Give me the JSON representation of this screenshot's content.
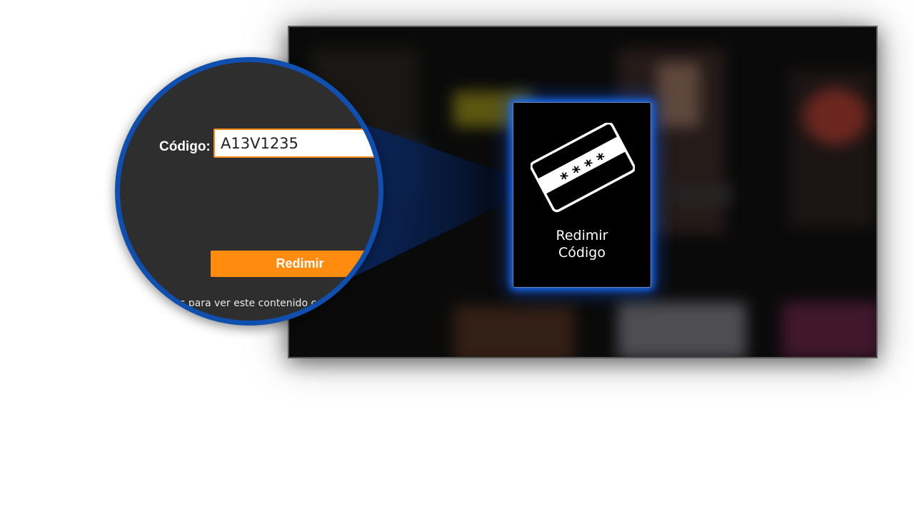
{
  "magnifier": {
    "code_label": "Código:",
    "code_input_value": "A13V1235",
    "redeem_button_label": "Redimir",
    "info_text_partial": "s para ver este contenido co"
  },
  "tile": {
    "label_line1": "Redimir",
    "label_line2": "Código",
    "icon": "card-code-icon",
    "card_mask": "* * * *"
  },
  "colors": {
    "accent_orange": "#ff8c0f",
    "magnifier_border": "#0f4fb0",
    "tile_glow": "#1973ff",
    "input_border": "#ff8c1a"
  }
}
